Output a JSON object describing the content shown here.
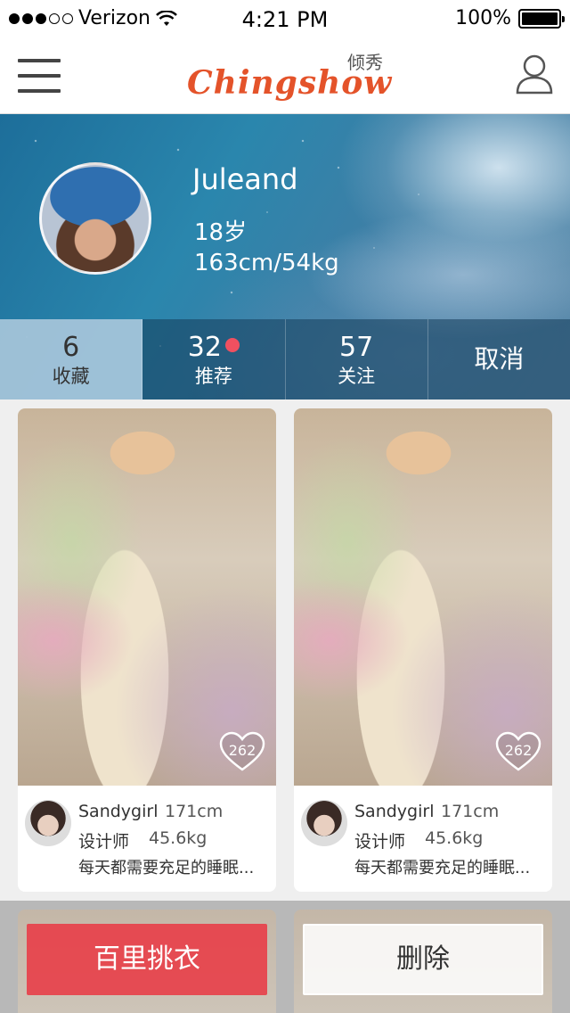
{
  "status_bar": {
    "carrier": "Verizon",
    "time": "4:21 PM",
    "battery": "100%",
    "signal_bars_filled": 3,
    "signal_bars_total": 5
  },
  "nav": {
    "logo_text": "Chingshow",
    "logo_sub": "倾秀",
    "menu_icon": "hamburger-menu-icon",
    "user_icon": "user-icon",
    "brand_color": "#e4532a"
  },
  "profile": {
    "name": "Juleand",
    "age": "18岁",
    "body": "163cm/54kg"
  },
  "stats": [
    {
      "count": "6",
      "label": "收藏"
    },
    {
      "count": "32",
      "label": "推荐",
      "has_notification": true
    },
    {
      "count": "57",
      "label": "关注"
    },
    {
      "label": "取消"
    }
  ],
  "cards": [
    {
      "likes": "262",
      "author": "Sandygirl",
      "height": "171cm",
      "role": "设计师",
      "weight": "45.6kg",
      "description": "每天都需要充足的睡眠..."
    },
    {
      "likes": "262",
      "author": "Sandygirl",
      "height": "171cm",
      "role": "设计师",
      "weight": "45.6kg",
      "description": "每天都需要充足的睡眠..."
    }
  ],
  "actions": {
    "primary_label": "百里挑衣",
    "secondary_label": "删除",
    "primary_color": "#e83e48"
  }
}
